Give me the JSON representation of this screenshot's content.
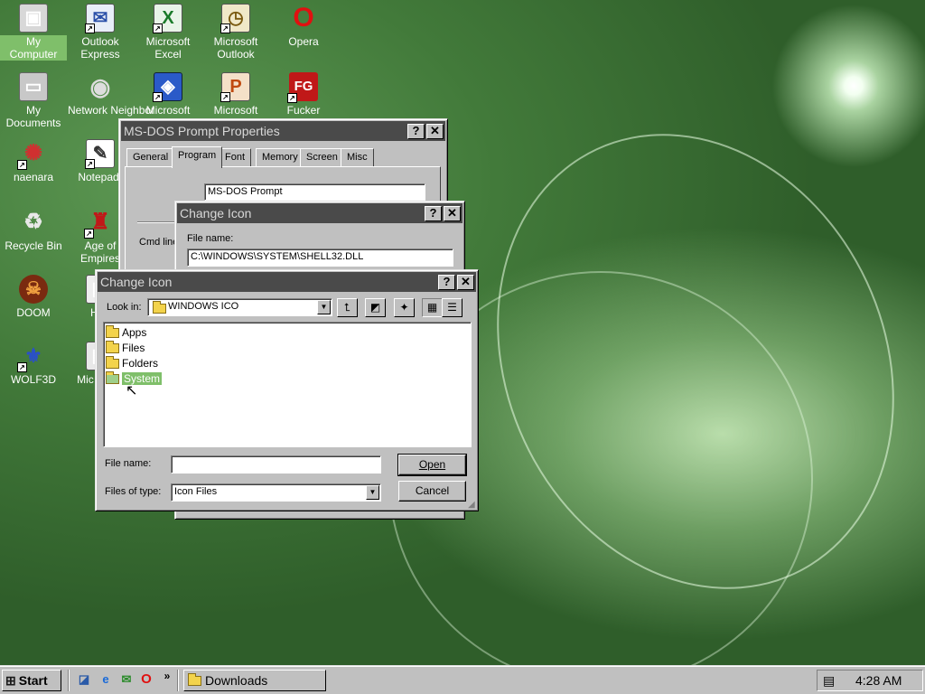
{
  "desktop": {
    "icons": [
      {
        "label": "My Computer",
        "icon": "computer-icon"
      },
      {
        "label": "Outlook Express",
        "icon": "outlook-express-icon"
      },
      {
        "label": "Microsoft Excel",
        "icon": "excel-icon"
      },
      {
        "label": "Microsoft Outlook",
        "icon": "outlook-icon"
      },
      {
        "label": "Opera",
        "icon": "opera-icon"
      },
      {
        "label": "My Documents",
        "icon": "documents-folder-icon"
      },
      {
        "label": "Network Neighbor",
        "icon": "network-icon"
      },
      {
        "label": "Microsoft",
        "icon": "microsoft-app-icon"
      },
      {
        "label": "Microsoft",
        "icon": "powerpoint-icon"
      },
      {
        "label": "Fucker",
        "icon": "fg-app-icon",
        "glyph": "FG"
      },
      {
        "label": "naenara",
        "icon": "naenara-icon"
      },
      {
        "label": "Notepad-",
        "icon": "notepad-icon"
      },
      {
        "label": "Recycle Bin",
        "icon": "recycle-bin-icon"
      },
      {
        "label": "Age of Empires",
        "icon": "age-of-empires-icon"
      },
      {
        "label": "DOOM",
        "icon": "doom-icon"
      },
      {
        "label": "He I",
        "icon": "shortcut-icon"
      },
      {
        "label": "WOLF3D",
        "icon": "wolf3d-icon"
      },
      {
        "label": "Mic Visua",
        "icon": "visual-studio-icon"
      }
    ]
  },
  "props_window": {
    "title": "MS-DOS Prompt Properties",
    "tabs": [
      "General",
      "Program",
      "Font",
      "Memory",
      "Screen",
      "Misc"
    ],
    "active_tab": "Program",
    "program_name": "MS-DOS Prompt",
    "cmd_label": "Cmd line"
  },
  "change_icon_back": {
    "title": "Change Icon",
    "file_label": "File name:",
    "file_value": "C:\\WINDOWS\\SYSTEM\\SHELL32.DLL"
  },
  "change_icon_front": {
    "title": "Change Icon",
    "look_in_label": "Look in:",
    "look_in_value": "WINDOWS ICO",
    "folders": [
      "Apps",
      "Files",
      "Folders",
      "System"
    ],
    "selected_folder": "System",
    "file_name_label": "File name:",
    "file_name_value": "",
    "files_of_type_label": "Files of type:",
    "files_of_type_value": "Icon Files",
    "open_label": "Open",
    "cancel_label": "Cancel",
    "help_glyph": "?",
    "close_glyph": "✕"
  },
  "taskbar": {
    "start_label": "Start",
    "more_glyph": "»",
    "task_label": "Downloads",
    "clock": "4:28 AM"
  },
  "colors": {
    "desktop_green": "#3f7637",
    "titlebar_inactive": "#4a4a4a",
    "selection_green": "#7fbf6a"
  }
}
